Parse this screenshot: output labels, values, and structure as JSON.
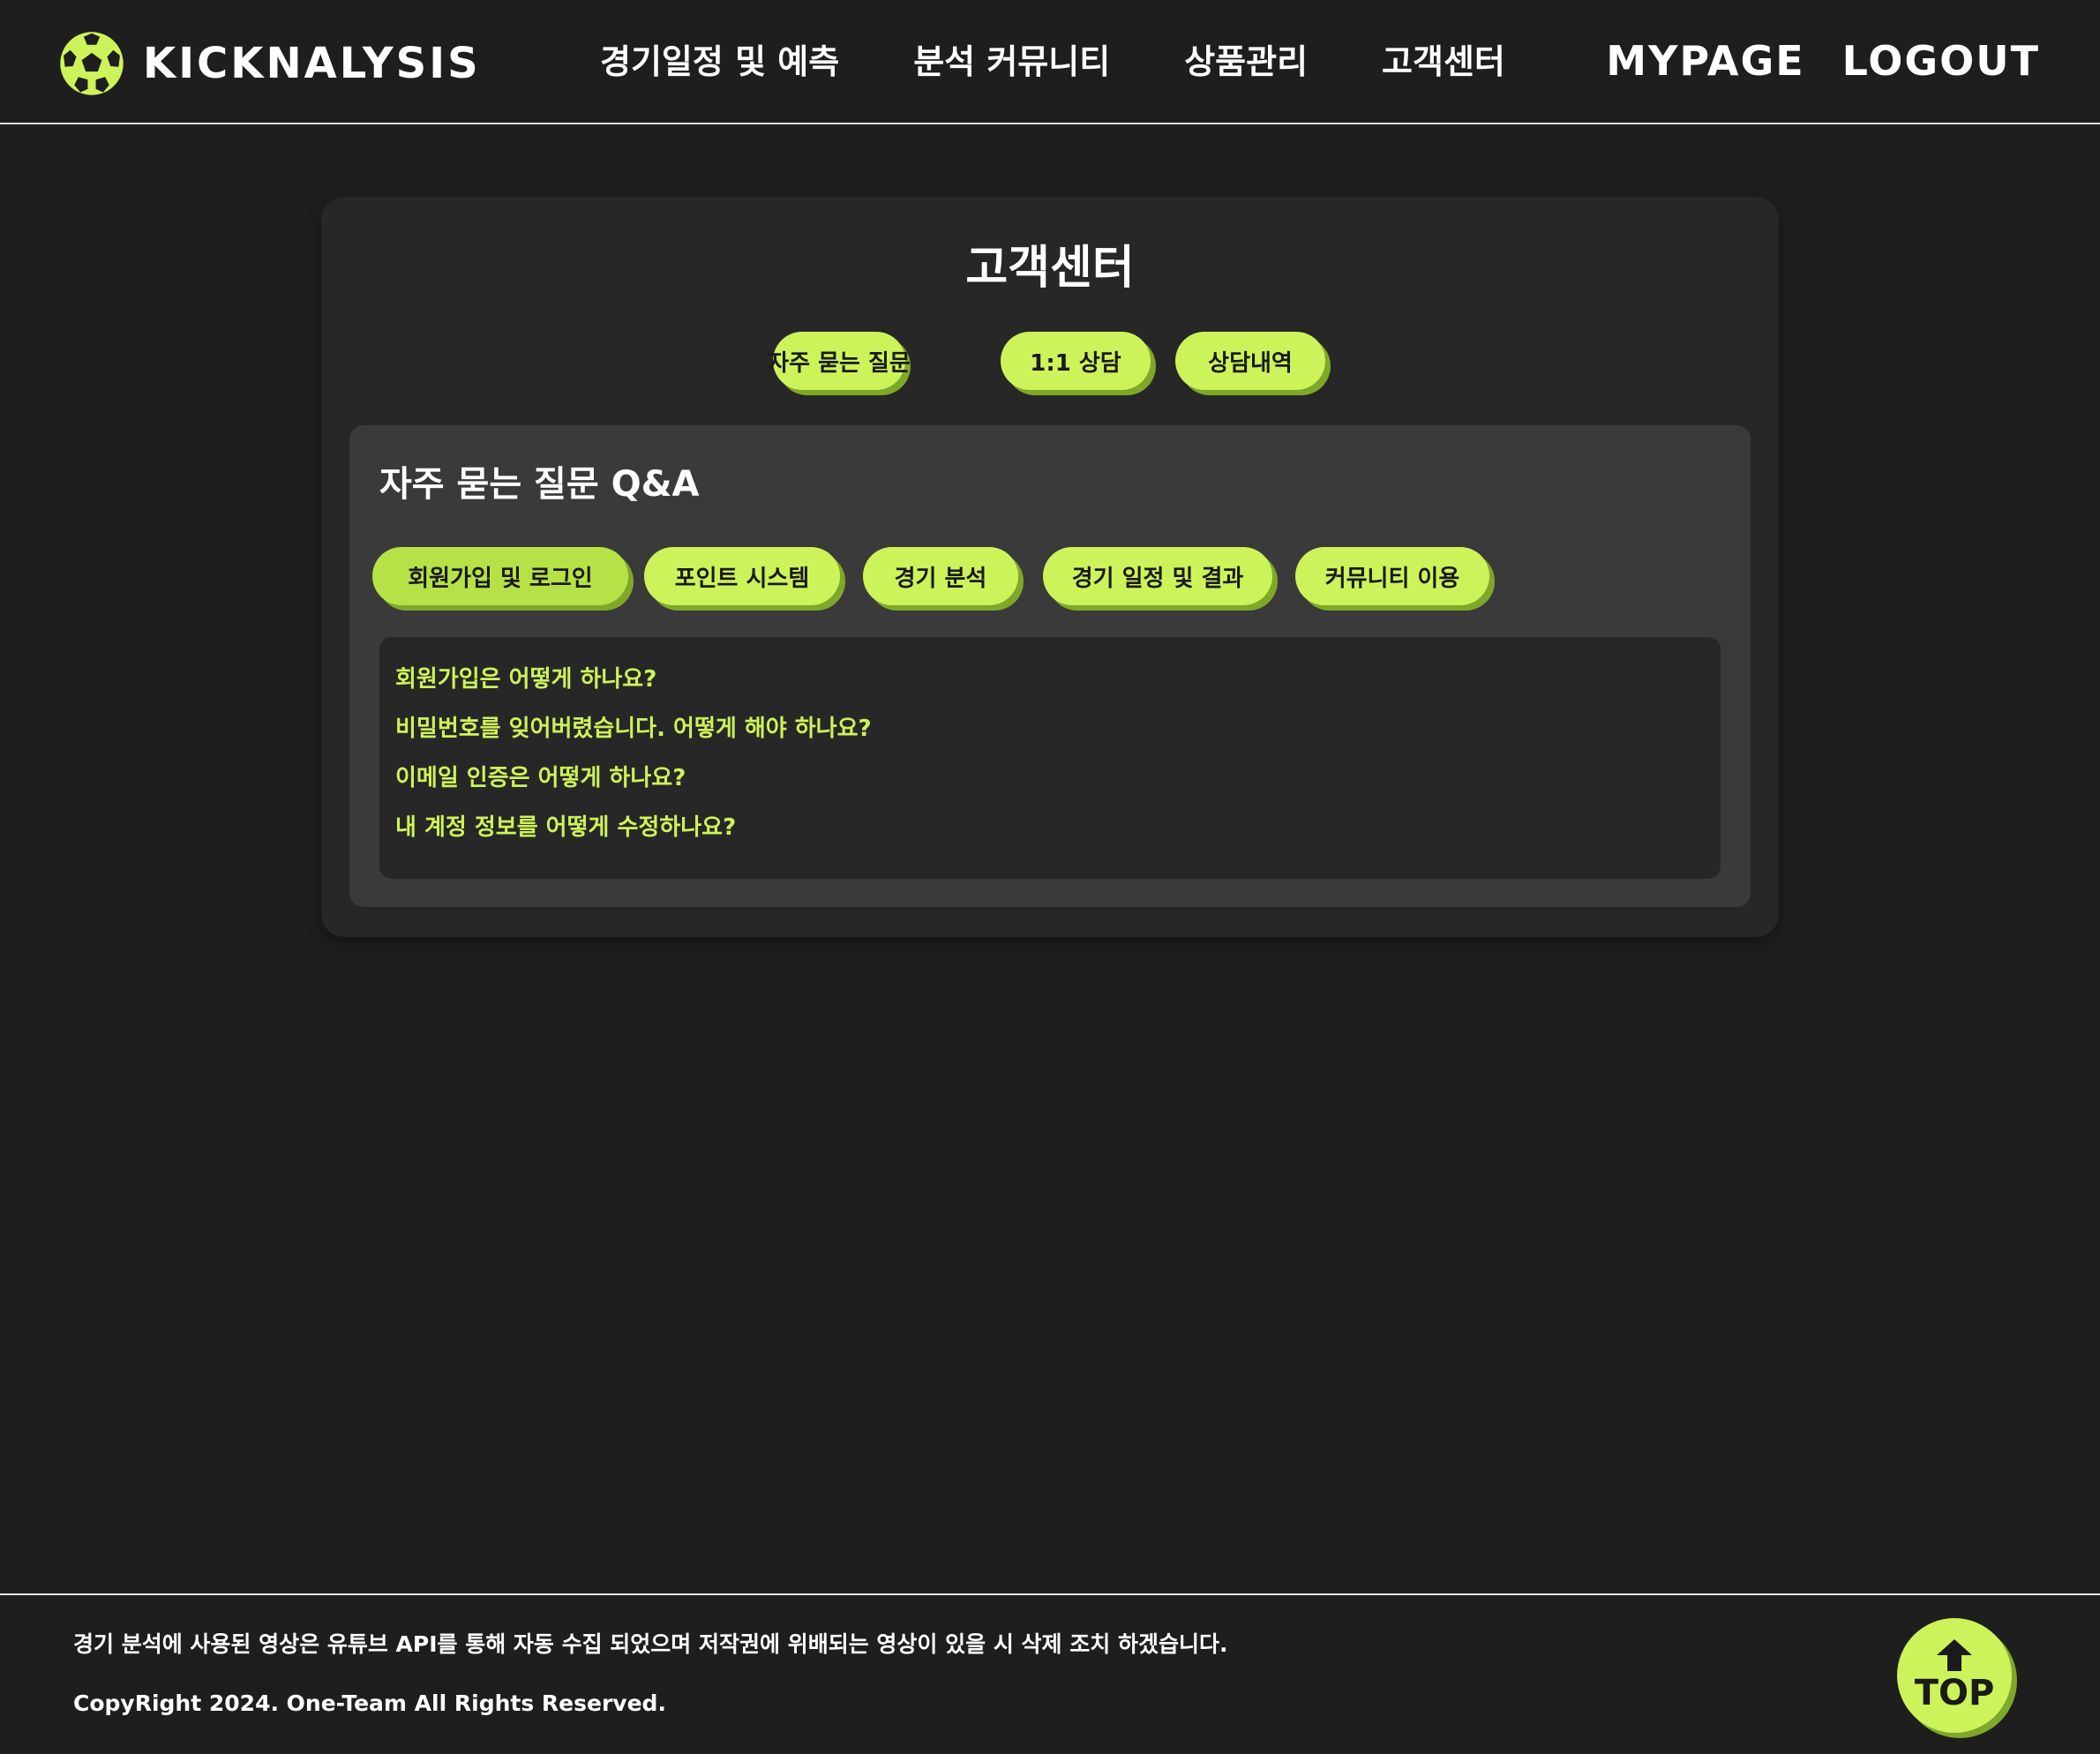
{
  "header": {
    "logo_text": "KICKNALYSIS",
    "logo_icon": "soccer-ball-icon",
    "nav": [
      {
        "label": "경기일정 및 예측"
      },
      {
        "label": "분석 커뮤니티"
      },
      {
        "label": "상품관리"
      },
      {
        "label": "고객센터"
      }
    ],
    "mypage_label": "MYPAGE",
    "logout_label": "LOGOUT"
  },
  "main": {
    "title": "고객센터",
    "tabs": [
      {
        "label": "자주 묻는 질문"
      },
      {
        "label": "1:1 상담"
      },
      {
        "label": "상담내역"
      }
    ],
    "faq": {
      "title": "자주 묻는 질문 Q&A",
      "categories": [
        {
          "label": "회원가입 및 로그인",
          "active": true
        },
        {
          "label": "포인트 시스템"
        },
        {
          "label": "경기 분석"
        },
        {
          "label": "경기 일정 및 결과"
        },
        {
          "label": "커뮤니티 이용"
        }
      ],
      "questions": [
        "회원가입은 어떻게 하나요?",
        "비밀번호를 잊어버렸습니다. 어떻게 해야 하나요?",
        "이메일 인증은 어떻게 하나요?",
        "내 계정 정보를 어떻게 수정하나요?"
      ]
    }
  },
  "footer": {
    "note": "경기 분석에 사용된 영상은 유튜브 API를 통해 자동 수집 되었으며 저작권에 위배되는 영상이 있을 시 삭제 조치 하겠습니다.",
    "copyright": "CopyRight 2024. One-Team All Rights Reserved.",
    "top_label": "TOP",
    "top_icon": "arrow-up-icon"
  },
  "colors": {
    "accent": "#cdf35a",
    "accent_shadow": "#7fa82a",
    "background": "#1e1e1e",
    "card": "#272727",
    "panel": "#3a3a3a"
  }
}
